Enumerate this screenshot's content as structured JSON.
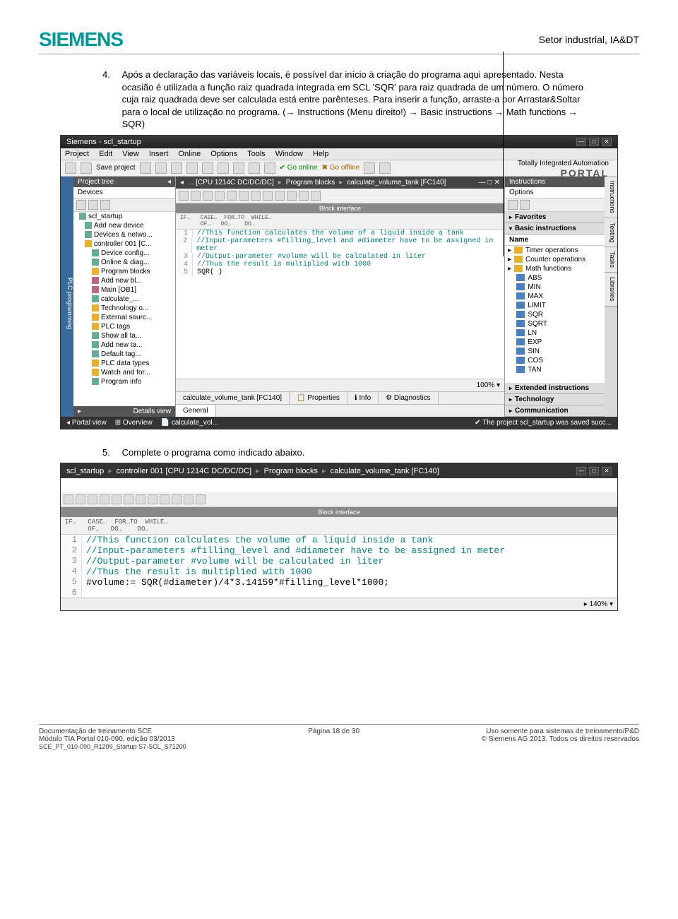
{
  "header": {
    "logo": "SIEMENS",
    "sector": "Setor industrial, IA&DT"
  },
  "step4": {
    "num": "4.",
    "text": "Após a declaração das variáveis locais, é possível dar início à criação do programa aqui apresentado. Nesta ocasião é utilizada a função raiz quadrada integrada em SCL 'SQR' para raiz quadrada de um número. O número cuja raiz quadrada deve ser calculada está entre parênteses. Para inserir a função, arraste-a por Arrastar&Soltar para o local de utilização no programa. (→ Instructions (Menu direito!) → Basic instructions → Math functions → SQR)"
  },
  "step5": {
    "num": "5.",
    "text": "Complete o programa como indicado abaixo."
  },
  "app": {
    "title": "Siemens - scl_startup",
    "menus": [
      "Project",
      "Edit",
      "View",
      "Insert",
      "Online",
      "Options",
      "Tools",
      "Window",
      "Help"
    ],
    "toolbar": {
      "save": "Save project",
      "goonline": "Go online",
      "gooffline": "Go offline"
    },
    "totally": {
      "t": "Totally Integrated Automation",
      "p": "PORTAL"
    },
    "projtree": {
      "title": "Project tree",
      "devices": "Devices"
    },
    "tree": [
      {
        "lvl": 0,
        "ic": "d",
        "lbl": "scl_startup"
      },
      {
        "lvl": 1,
        "ic": "d",
        "lbl": "Add new device"
      },
      {
        "lvl": 1,
        "ic": "d",
        "lbl": "Devices & netwo..."
      },
      {
        "lvl": 1,
        "ic": "f",
        "lbl": "controller 001 [C..."
      },
      {
        "lvl": 2,
        "ic": "d",
        "lbl": "Device config..."
      },
      {
        "lvl": 2,
        "ic": "d",
        "lbl": "Online & diag..."
      },
      {
        "lvl": 2,
        "ic": "f",
        "lbl": "Program blocks"
      },
      {
        "lvl": 2,
        "ic": "p",
        "lbl": "Add new bl..."
      },
      {
        "lvl": 2,
        "ic": "p",
        "lbl": "Main [OB1]"
      },
      {
        "lvl": 2,
        "ic": "d",
        "lbl": "calculate_..."
      },
      {
        "lvl": 2,
        "ic": "f",
        "lbl": "Technology o..."
      },
      {
        "lvl": 2,
        "ic": "f",
        "lbl": "External sourc..."
      },
      {
        "lvl": 2,
        "ic": "f",
        "lbl": "PLC tags"
      },
      {
        "lvl": 2,
        "ic": "d",
        "lbl": "Show all ta..."
      },
      {
        "lvl": 2,
        "ic": "d",
        "lbl": "Add new ta..."
      },
      {
        "lvl": 2,
        "ic": "d",
        "lbl": "Default tag..."
      },
      {
        "lvl": 2,
        "ic": "f",
        "lbl": "PLC data types"
      },
      {
        "lvl": 2,
        "ic": "f",
        "lbl": "Watch and for..."
      },
      {
        "lvl": 2,
        "ic": "d",
        "lbl": "Program info"
      }
    ],
    "details": "Details view",
    "breadcrumb": [
      "... [CPU 1214C DC/DC/DC]",
      "Program blocks",
      "calculate_volume_tank [FC140]"
    ],
    "blkif": "Block interface",
    "codehdr": "IF…   CASE…  FOR…TO  WHILE…\n      OF…   DO…    DO…",
    "code": [
      {
        "n": "1",
        "t": "//This function calculates the volume of a liquid inside a tank",
        "c": true
      },
      {
        "n": "2",
        "t": "//Input-parameters #filling_level and #diameter have to be assigned in meter",
        "c": true
      },
      {
        "n": "3",
        "t": "//Output-parameter #volume will be calculated in liter",
        "c": true
      },
      {
        "n": "4",
        "t": "//Thus the result is multiplied with 1000",
        "c": true
      },
      {
        "n": "5",
        "t": "SQR(  )",
        "c": false
      }
    ],
    "proptabs": {
      "calc": "calculate_volume_tank [FC140]",
      "props": "Properties",
      "info": "Info",
      "diag": "Diagnostics",
      "gen": "General"
    },
    "zoom": "100%",
    "instr": {
      "title": "Instructions",
      "options": "Options",
      "fav": "Favorites",
      "basic": "Basic instructions",
      "name": "Name"
    },
    "funcs": [
      {
        "ic": "c",
        "lbl": "Timer operations"
      },
      {
        "ic": "c",
        "lbl": "Counter operations"
      },
      {
        "ic": "c",
        "lbl": "Math functions"
      },
      {
        "ic": "",
        "lbl": "ABS"
      },
      {
        "ic": "",
        "lbl": "MIN"
      },
      {
        "ic": "",
        "lbl": "MAX"
      },
      {
        "ic": "",
        "lbl": "LIMIT"
      },
      {
        "ic": "",
        "lbl": "SQR"
      },
      {
        "ic": "",
        "lbl": "SQRT"
      },
      {
        "ic": "",
        "lbl": "LN"
      },
      {
        "ic": "",
        "lbl": "EXP"
      },
      {
        "ic": "",
        "lbl": "SIN"
      },
      {
        "ic": "",
        "lbl": "COS"
      },
      {
        "ic": "",
        "lbl": "TAN"
      }
    ],
    "ext": "Extended instructions",
    "tech": "Technology",
    "comm": "Communication",
    "sidetabs": [
      "Instructions",
      "Testing",
      "Tasks",
      "Libraries"
    ],
    "status": {
      "portal": "Portal view",
      "overview": "Overview",
      "calc": "calculate_vol...",
      "msg": "The project scl_startup was saved succ..."
    }
  },
  "app2": {
    "breadcrumb": [
      "scl_startup",
      "controller 001 [CPU 1214C DC/DC/DC]",
      "Program blocks",
      "calculate_volume_tank [FC140]"
    ],
    "blkif": "Block interface",
    "codehdr": "IF…   CASE…  FOR…TO  WHILE…\n      OF…   DO…    DO…",
    "code": [
      {
        "n": "1",
        "t": "//This function calculates the volume of a liquid inside a tank",
        "c": true
      },
      {
        "n": "2",
        "t": "//Input-parameters #filling_level and #diameter have to be assigned in meter",
        "c": true
      },
      {
        "n": "3",
        "t": "//Output-parameter #volume will be calculated in liter",
        "c": true
      },
      {
        "n": "4",
        "t": "//Thus the result is multiplied with 1000",
        "c": true
      },
      {
        "n": "5",
        "t": "#volume:= SQR(#diameter)/4*3.14159*#filling_level*1000;",
        "c": false
      },
      {
        "n": "6",
        "t": "",
        "c": false
      }
    ],
    "zoom": "140%"
  },
  "footer": {
    "l1": "Documentação de treinamento SCE",
    "l2": "Módulo TIA Portal 010-090, edição 03/2013",
    "l3": "SCE_PT_010-090_R1209_Startup S7-SCL_S71200",
    "c": "Página 18 de 30",
    "r1": "Uso somente para sistemas de treinamento/P&D",
    "r2": "© Siemens AG 2013. Todos os direitos reservados"
  }
}
